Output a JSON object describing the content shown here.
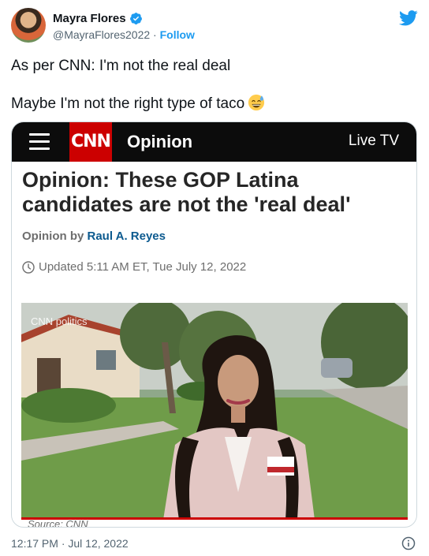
{
  "author": {
    "name": "Mayra Flores",
    "handle": "@MayraFlores2022",
    "separator": "·",
    "follow_label": "Follow",
    "verified": true
  },
  "tweet": {
    "line1": "As per CNN: I'm not the real deal",
    "line2": "Maybe I'm not the right type of taco",
    "emoji_icon": "sweat-smile-emoji"
  },
  "card": {
    "brand": "CNN",
    "section": "Opinion",
    "live_label": "Live TV",
    "headline": "Opinion: These GOP Latina candidates are not the 'real deal'",
    "byline_prefix": "Opinion by",
    "byline_author": "Raul A. Reyes",
    "updated": "Updated 5:11 AM ET, Tue July 12, 2022",
    "watermark": "CNN politics",
    "source": "Source: CNN"
  },
  "footer": {
    "timestamp": "12:17 PM · Jul 12, 2022"
  },
  "colors": {
    "twitter_blue": "#1d9bf0",
    "cnn_red": "#cc0000",
    "cnn_black": "#0c0c0c"
  }
}
